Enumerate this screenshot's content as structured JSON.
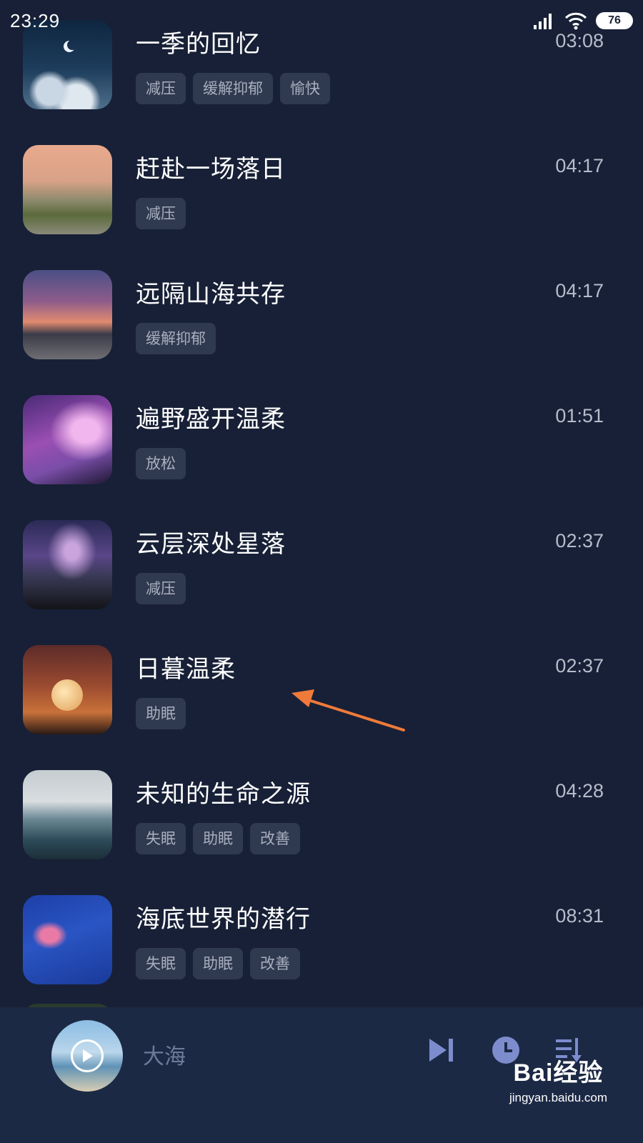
{
  "status_bar": {
    "time": "23:29",
    "battery": "76"
  },
  "tracks": [
    {
      "title": "一季的回忆",
      "duration": "03:08",
      "tags": [
        "减压",
        "缓解抑郁",
        "愉快"
      ]
    },
    {
      "title": "赶赴一场落日",
      "duration": "04:17",
      "tags": [
        "减压"
      ]
    },
    {
      "title": "远隔山海共存",
      "duration": "04:17",
      "tags": [
        "缓解抑郁"
      ]
    },
    {
      "title": "遍野盛开温柔",
      "duration": "01:51",
      "tags": [
        "放松"
      ]
    },
    {
      "title": "云层深处星落",
      "duration": "02:37",
      "tags": [
        "减压"
      ]
    },
    {
      "title": "日暮温柔",
      "duration": "02:37",
      "tags": [
        "助眠"
      ]
    },
    {
      "title": "未知的生命之源",
      "duration": "04:28",
      "tags": [
        "失眠",
        "助眠",
        "改善"
      ]
    },
    {
      "title": "海底世界的潜行",
      "duration": "08:31",
      "tags": [
        "失眠",
        "助眠",
        "改善"
      ]
    }
  ],
  "player": {
    "now_playing": "大海"
  },
  "watermark": {
    "brand": "Bai经验",
    "url": "jingyan.baidu.com"
  },
  "colors": {
    "background": "#172036",
    "tag_bg": "#2f394f",
    "arrow": "#f07a3a"
  }
}
